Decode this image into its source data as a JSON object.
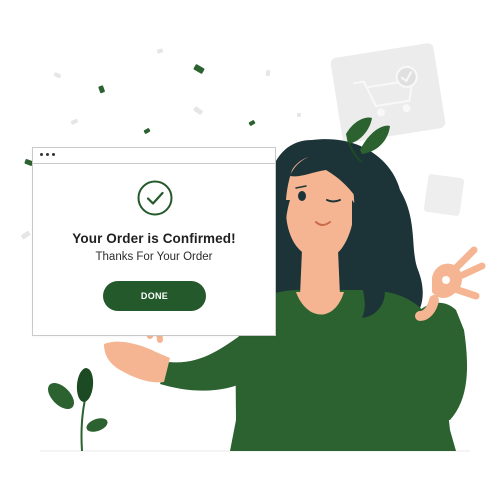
{
  "confirmation": {
    "title": "Your Order is Confirmed!",
    "subtitle": "Thanks For Your Order",
    "done_label": "DONE",
    "icon": "check-circle-icon"
  },
  "colors": {
    "accent": "#245a2b",
    "hair": "#1c3438",
    "shirt": "#2b6230",
    "skin": "#f6b592",
    "confetti_green": "#2b6230",
    "confetti_gray": "#e6e6e6"
  },
  "decorations": {
    "background_icon": "shopping-cart-icon",
    "plant_icon": "plant-icon",
    "leaf_icon": "leaf-icon"
  }
}
